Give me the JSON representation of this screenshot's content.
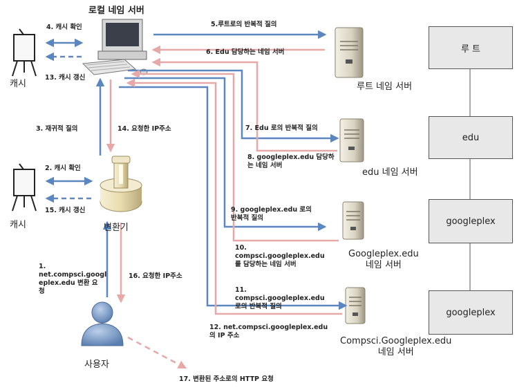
{
  "title": "로컬 네임 서버",
  "nodes": {
    "local_server": "로컬 네임 서버",
    "cache_top": "캐시",
    "cache_bottom": "캐시",
    "converter": "변환기",
    "user": "사용자",
    "root_server": "루트 네임 서버",
    "edu_server": "edu 네임 서버",
    "googleplex_server": "Googleplex.edu\n네임 서버",
    "compsci_server": "Compsci.Googleplex.edu\n네임 서버"
  },
  "hierarchy": [
    "루 트",
    "edu",
    "googleplex",
    "googleplex"
  ],
  "steps": {
    "s1": "1.\nnet.compsci.googl\neplex.edu 변환 요\n청",
    "s2": "2. 캐시 확인",
    "s3": "3. 재귀적 질의",
    "s4": "4. 캐시 확인",
    "s5": "5.루트로의 반복적 질의",
    "s6": "6. Edu 담당하는 네임 서버",
    "s7": "7. Edu 로의 반복적 질의",
    "s8": "8. googleplex.edu 담당하\n는 네임 서버",
    "s9": "9. googleplex.edu 로의\n반복적 질의",
    "s10": "10.\ncompsci.googleplex.edu\n를 담당하는 네임 서버",
    "s11": "11.\ncompsci.googleplex.edu\n로의 반복적 질의",
    "s12": "12. net.compsci.googleplex.edu\n의 IP 주소",
    "s13": "13. 캐시 갱신",
    "s14": "14. 요청한 IP주소",
    "s15": "15. 캐시 갱신",
    "s16": "16. 요청한 IP주소",
    "s17": "17. 변환된 주소로의 HTTP 요청"
  },
  "colors": {
    "query_arrow": "#5b86c0",
    "response_arrow": "#e7a8a8",
    "hierarchy_box": "#e8e8e8"
  }
}
